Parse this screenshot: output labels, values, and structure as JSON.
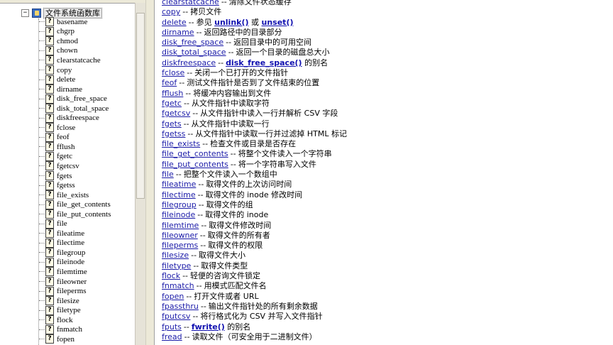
{
  "tree": {
    "root": {
      "expander": "−",
      "label": "文件系统函数库"
    },
    "item_icon_glyph": "?",
    "items": [
      "basename",
      "chgrp",
      "chmod",
      "chown",
      "clearstatcache",
      "copy",
      "delete",
      "dirname",
      "disk_free_space",
      "disk_total_space",
      "diskfreespace",
      "fclose",
      "feof",
      "fflush",
      "fgetc",
      "fgetcsv",
      "fgets",
      "fgetss",
      "file_exists",
      "file_get_contents",
      "file_put_contents",
      "file",
      "fileatime",
      "filectime",
      "filegroup",
      "fileinode",
      "filemtime",
      "fileowner",
      "fileperms",
      "filesize",
      "filetype",
      "flock",
      "fnmatch",
      "fopen"
    ]
  },
  "sep": "--",
  "functions": [
    {
      "name": "clearstatcache",
      "parts": [
        {
          "t": "清除文件状态缓存"
        }
      ]
    },
    {
      "name": "copy",
      "parts": [
        {
          "t": "拷贝文件"
        }
      ]
    },
    {
      "name": "delete",
      "parts": [
        {
          "t": "参见 "
        },
        {
          "link": "unlink()"
        },
        {
          "t": " 或 "
        },
        {
          "link": "unset()"
        }
      ]
    },
    {
      "name": "dirname",
      "parts": [
        {
          "t": "返回路径中的目录部分"
        }
      ]
    },
    {
      "name": "disk_free_space",
      "parts": [
        {
          "t": "返回目录中的可用空间"
        }
      ]
    },
    {
      "name": "disk_total_space",
      "parts": [
        {
          "t": "返回一个目录的磁盘总大小"
        }
      ]
    },
    {
      "name": "diskfreespace",
      "parts": [
        {
          "link": "disk_free_space()"
        },
        {
          "t": " 的别名"
        }
      ]
    },
    {
      "name": "fclose",
      "parts": [
        {
          "t": "关闭一个已打开的文件指针"
        }
      ]
    },
    {
      "name": "feof",
      "parts": [
        {
          "t": "测试文件指针是否到了文件结束的位置"
        }
      ]
    },
    {
      "name": "fflush",
      "parts": [
        {
          "t": "将缓冲内容输出到文件"
        }
      ]
    },
    {
      "name": "fgetc",
      "parts": [
        {
          "t": "从文件指针中读取字符"
        }
      ]
    },
    {
      "name": "fgetcsv",
      "parts": [
        {
          "t": "从文件指针中读入一行并解析 CSV 字段"
        }
      ]
    },
    {
      "name": "fgets",
      "parts": [
        {
          "t": "从文件指针中读取一行"
        }
      ]
    },
    {
      "name": "fgetss",
      "parts": [
        {
          "t": "从文件指针中读取一行并过滤掉 HTML 标记"
        }
      ]
    },
    {
      "name": "file_exists",
      "parts": [
        {
          "t": "检查文件或目录是否存在"
        }
      ]
    },
    {
      "name": "file_get_contents",
      "parts": [
        {
          "t": "将整个文件读入一个字符串"
        }
      ]
    },
    {
      "name": "file_put_contents",
      "parts": [
        {
          "t": "将一个字符串写入文件"
        }
      ]
    },
    {
      "name": "file",
      "parts": [
        {
          "t": "把整个文件读入一个数组中"
        }
      ]
    },
    {
      "name": "fileatime",
      "parts": [
        {
          "t": "取得文件的上次访问时间"
        }
      ]
    },
    {
      "name": "filectime",
      "parts": [
        {
          "t": "取得文件的 inode 修改时间"
        }
      ]
    },
    {
      "name": "filegroup",
      "parts": [
        {
          "t": "取得文件的组"
        }
      ]
    },
    {
      "name": "fileinode",
      "parts": [
        {
          "t": "取得文件的 inode"
        }
      ]
    },
    {
      "name": "filemtime",
      "parts": [
        {
          "t": "取得文件修改时间"
        }
      ]
    },
    {
      "name": "fileowner",
      "parts": [
        {
          "t": "取得文件的所有者"
        }
      ]
    },
    {
      "name": "fileperms",
      "parts": [
        {
          "t": "取得文件的权限"
        }
      ]
    },
    {
      "name": "filesize",
      "parts": [
        {
          "t": "取得文件大小"
        }
      ]
    },
    {
      "name": "filetype",
      "parts": [
        {
          "t": "取得文件类型"
        }
      ]
    },
    {
      "name": "flock",
      "parts": [
        {
          "t": "轻便的咨询文件锁定"
        }
      ]
    },
    {
      "name": "fnmatch",
      "parts": [
        {
          "t": "用模式匹配文件名"
        }
      ]
    },
    {
      "name": "fopen",
      "parts": [
        {
          "t": "打开文件或者 URL"
        }
      ]
    },
    {
      "name": "fpassthru",
      "parts": [
        {
          "t": "输出文件指针处的所有剩余数据"
        }
      ]
    },
    {
      "name": "fputcsv",
      "parts": [
        {
          "t": "将行格式化为 CSV 并写入文件指针"
        }
      ]
    },
    {
      "name": "fputs",
      "parts": [
        {
          "link": "fwrite()"
        },
        {
          "t": " 的别名"
        }
      ]
    },
    {
      "name": "fread",
      "parts": [
        {
          "t": "读取文件（可安全用于二进制文件）"
        }
      ]
    }
  ]
}
